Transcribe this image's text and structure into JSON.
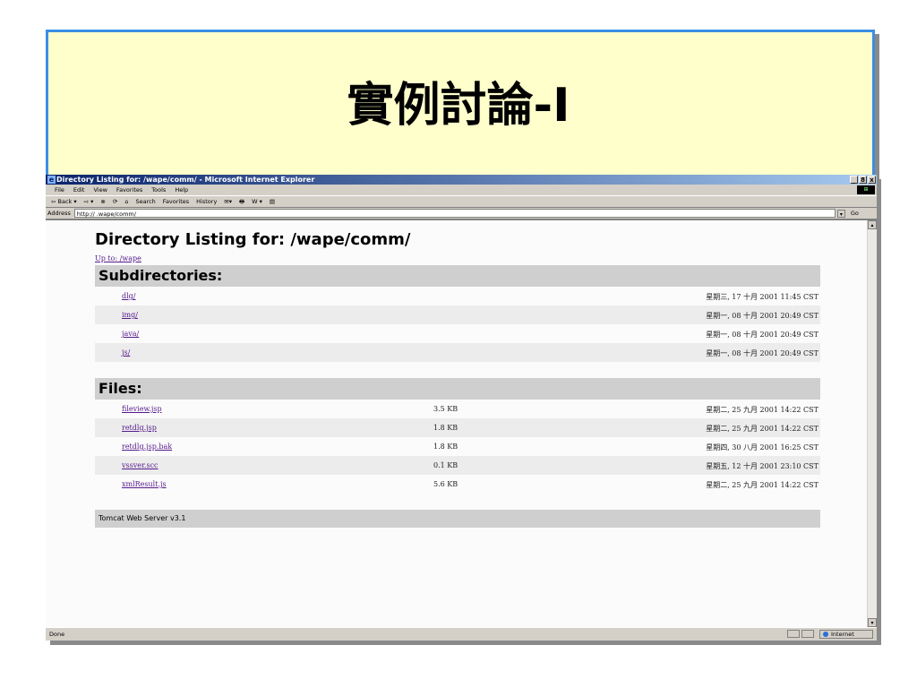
{
  "slide": {
    "title": "實例討論-I"
  },
  "window": {
    "title": "Directory Listing for: /wape/comm/ - Microsoft Internet Explorer",
    "controls": [
      "_",
      "8",
      "x"
    ]
  },
  "menu": {
    "items": [
      "File",
      "Edit",
      "View",
      "Favorites",
      "Tools",
      "Help"
    ]
  },
  "toolbar": {
    "items": [
      "⇦ Back ▾",
      "⇨ ▾",
      "⊗",
      "⟳",
      "⌂",
      "Search",
      "Favorites",
      "History",
      "✉▾",
      "🖶",
      "W ▾",
      "▤"
    ]
  },
  "address": {
    "label": "Address",
    "value": "http://         .wape/comm/",
    "go_label": "Go"
  },
  "page": {
    "heading": "Directory Listing for: /wape/comm/",
    "up_link": "Up to: /wape",
    "subdirs_title": "Subdirectories:",
    "subdirs": [
      {
        "name": "dlg/",
        "date": "星期三, 17 十月 2001 11:45 CST"
      },
      {
        "name": "img/",
        "date": "星期一, 08 十月 2001 20:49 CST"
      },
      {
        "name": "java/",
        "date": "星期一, 08 十月 2001 20:49 CST"
      },
      {
        "name": "js/",
        "date": "星期一, 08 十月 2001 20:49 CST"
      }
    ],
    "files_title": "Files:",
    "files": [
      {
        "name": "fileview.jsp",
        "size": "3.5 KB",
        "date": "星期二, 25 九月 2001 14:22 CST"
      },
      {
        "name": "retdlg.jsp",
        "size": "1.8 KB",
        "date": "星期二, 25 九月 2001 14:22 CST"
      },
      {
        "name": "retdlg.jsp.bak",
        "size": "1.8 KB",
        "date": "星期四, 30 八月 2001 16:25 CST"
      },
      {
        "name": "vssver.scc",
        "size": "0.1 KB",
        "date": "星期五, 12 十月 2001 23:10 CST"
      },
      {
        "name": "xmlResult.js",
        "size": "5.6 KB",
        "date": "星期二, 25 九月 2001 14:22 CST"
      }
    ],
    "footer": "Tomcat Web Server v3.1"
  },
  "status": {
    "left": "Done",
    "zone": "Internet"
  }
}
